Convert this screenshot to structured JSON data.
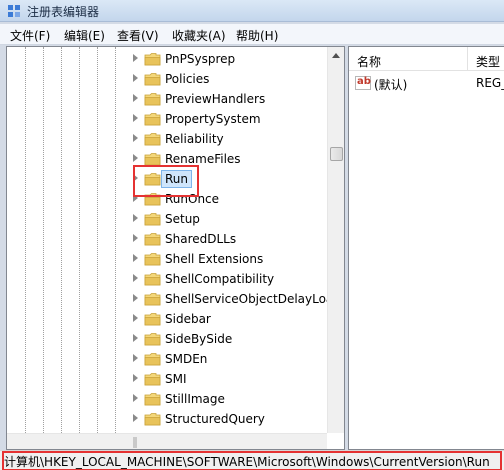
{
  "window": {
    "title": "注册表编辑器"
  },
  "menu": [
    {
      "label": "文件(F)"
    },
    {
      "label": "编辑(E)"
    },
    {
      "label": "查看(V)"
    },
    {
      "label": "收藏夹(A)"
    },
    {
      "label": "帮助(H)"
    }
  ],
  "tree": {
    "items": [
      {
        "label": "PnPSysprep"
      },
      {
        "label": "Policies"
      },
      {
        "label": "PreviewHandlers"
      },
      {
        "label": "PropertySystem"
      },
      {
        "label": "Reliability"
      },
      {
        "label": "RenameFiles"
      },
      {
        "label": "Run",
        "selected": true
      },
      {
        "label": "RunOnce"
      },
      {
        "label": "Setup"
      },
      {
        "label": "SharedDLLs"
      },
      {
        "label": "Shell Extensions"
      },
      {
        "label": "ShellCompatibility"
      },
      {
        "label": "ShellServiceObjectDelayLoad"
      },
      {
        "label": "Sidebar"
      },
      {
        "label": "SideBySide"
      },
      {
        "label": "SMDEn"
      },
      {
        "label": "SMI"
      },
      {
        "label": "StillImage"
      },
      {
        "label": "StructuredQuery"
      }
    ]
  },
  "list": {
    "columns": {
      "name": "名称",
      "type": "类型"
    },
    "rows": [
      {
        "icon": "string-value-icon",
        "name": "(默认)",
        "type": "REG_SZ"
      }
    ]
  },
  "status": {
    "path": "计算机\\HKEY_LOCAL_MACHINE\\SOFTWARE\\Microsoft\\Windows\\CurrentVersion\\Run"
  },
  "colors": {
    "highlight": "#e53232",
    "selection": "#cfe5fb",
    "folder": "#e8c35a"
  }
}
